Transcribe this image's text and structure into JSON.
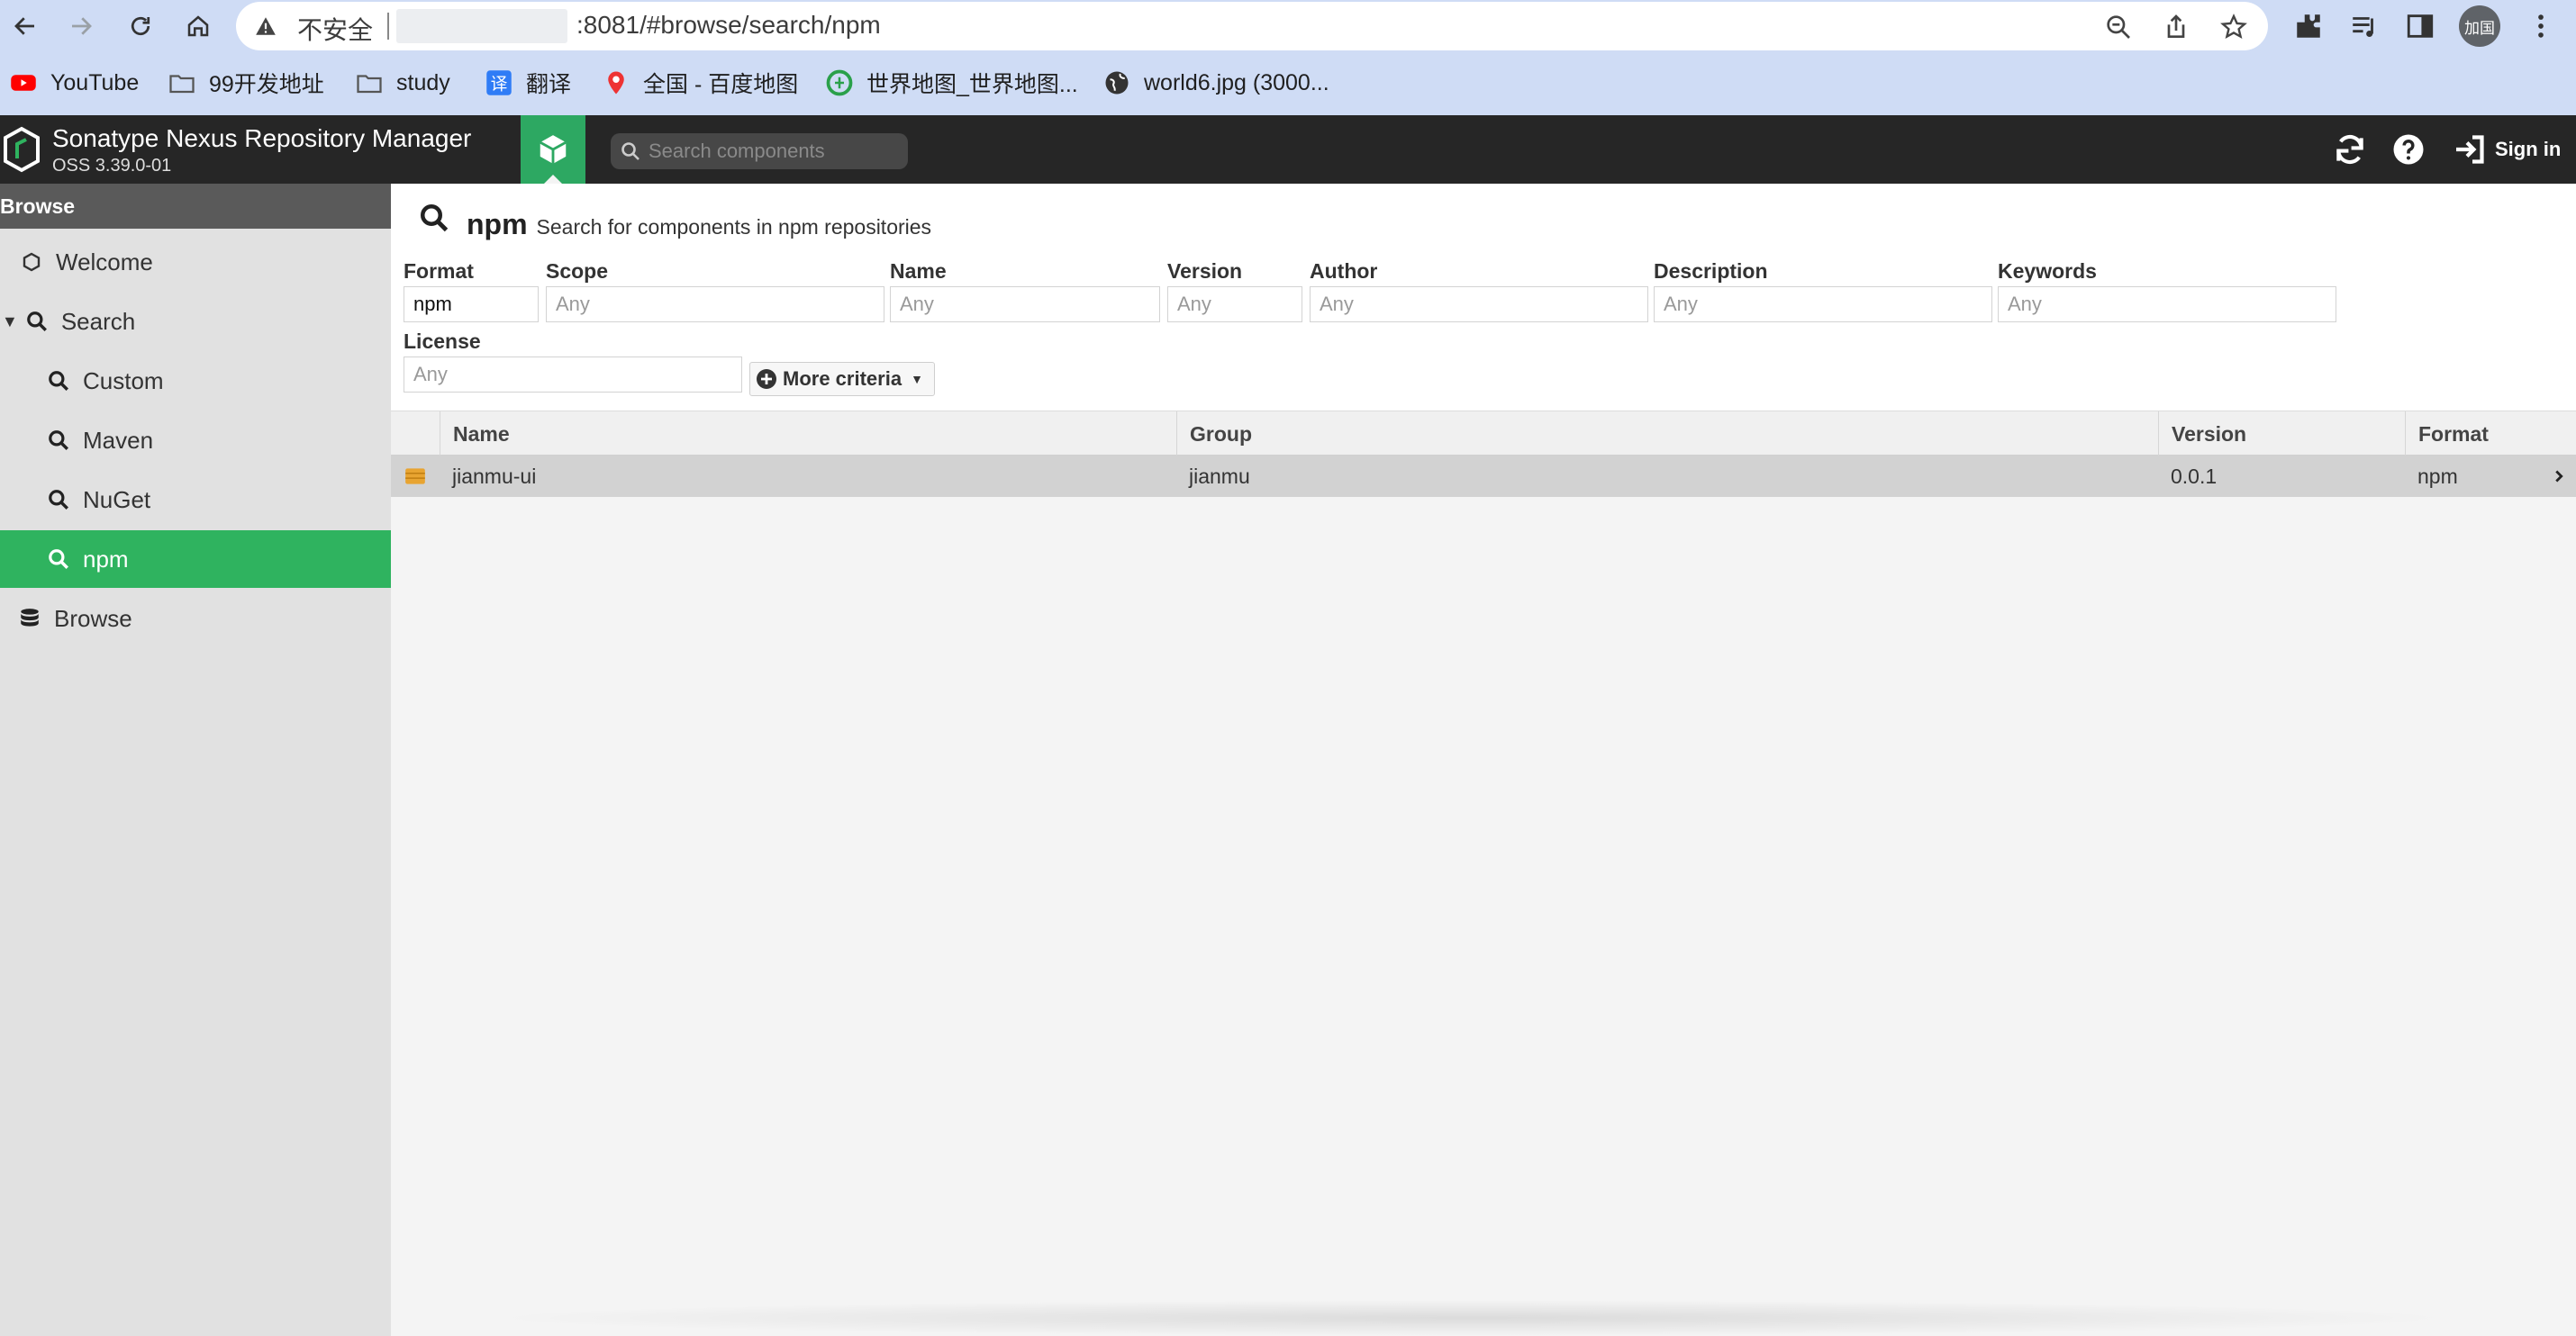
{
  "browser": {
    "insecure_label": "不安全",
    "url": ":8081/#browse/search/npm",
    "profile_label": "加国",
    "bookmarks": [
      {
        "label": "YouTube",
        "icon": "youtube-icon"
      },
      {
        "label": "99开发地址",
        "icon": "folder-icon"
      },
      {
        "label": "study",
        "icon": "folder-icon"
      },
      {
        "label": "翻译",
        "icon": "translate-icon"
      },
      {
        "label": "全国 - 百度地图",
        "icon": "map-pin-icon"
      },
      {
        "label": "世界地图_世界地图...",
        "icon": "globe-map-icon"
      },
      {
        "label": "world6.jpg (3000...",
        "icon": "globe-icon"
      }
    ]
  },
  "app": {
    "title": "Sonatype Nexus Repository Manager",
    "version": "OSS 3.39.0-01",
    "search_placeholder": "Search components",
    "sign_in": "Sign in"
  },
  "sidebar": {
    "header": "Browse",
    "items": [
      {
        "label": "Welcome",
        "icon": "hexagon-icon"
      },
      {
        "label": "Search",
        "icon": "search-icon"
      },
      {
        "label": "Custom",
        "icon": "search-icon"
      },
      {
        "label": "Maven",
        "icon": "search-icon"
      },
      {
        "label": "NuGet",
        "icon": "search-icon"
      },
      {
        "label": "npm",
        "icon": "search-icon",
        "active": true
      },
      {
        "label": "Browse",
        "icon": "database-icon"
      }
    ]
  },
  "page": {
    "title": "npm",
    "subtitle": "Search for components in npm repositories"
  },
  "criteria": {
    "format": {
      "label": "Format",
      "value": "npm"
    },
    "scope": {
      "label": "Scope",
      "placeholder": "Any"
    },
    "name": {
      "label": "Name",
      "placeholder": "Any"
    },
    "version": {
      "label": "Version",
      "placeholder": "Any"
    },
    "author": {
      "label": "Author",
      "placeholder": "Any"
    },
    "description": {
      "label": "Description",
      "placeholder": "Any"
    },
    "keywords": {
      "label": "Keywords",
      "placeholder": "Any"
    },
    "license": {
      "label": "License",
      "placeholder": "Any"
    },
    "more_label": "More criteria"
  },
  "grid": {
    "columns": [
      "Name",
      "Group",
      "Version",
      "Format"
    ],
    "rows": [
      {
        "name": "jianmu-ui",
        "group": "jianmu",
        "version": "0.0.1",
        "format": "npm"
      }
    ]
  },
  "colors": {
    "accent_green": "#2fb35f",
    "header_dark": "#262626",
    "browser_chrome": "#cfdcf5"
  }
}
